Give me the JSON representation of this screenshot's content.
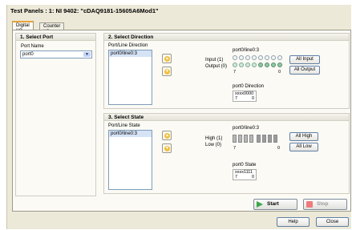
{
  "window": {
    "title": "Test Panels : 1:  NI 9402: \"cDAQ9181-15605A6Mod1\""
  },
  "tabs": [
    {
      "label": "Digital I/O"
    },
    {
      "label": "Counter I/O"
    }
  ],
  "select_port": {
    "title": "1. Select Port",
    "port_name_label": "Port Name",
    "port_value": "port0"
  },
  "direction": {
    "title": "2. Select Direction",
    "list_label": "Port/Line Direction",
    "list_items": [
      "port0/line0:3"
    ],
    "lines_label": "port0/line0:3",
    "input_label": "Input (1)",
    "output_label": "Output (0)",
    "scale_high": "7",
    "scale_low": "0",
    "all_input": "All Input",
    "all_output": "All Output",
    "readout_label": "port0 Direction",
    "readout_value": "xxxx0000",
    "readout_high": "7",
    "readout_low": "0"
  },
  "state": {
    "title": "3. Select State",
    "list_label": "Port/Line State",
    "list_items": [
      "port0/line0:3"
    ],
    "lines_label": "port0/line0:3",
    "high_label": "High (1)",
    "low_label": "Low (0)",
    "scale_high": "7",
    "scale_low": "0",
    "all_high": "All High",
    "all_low": "All Low",
    "readout_label": "port0 State",
    "readout_value": "xxxx1111",
    "readout_high": "7",
    "readout_low": "0"
  },
  "actions": {
    "start": "Start",
    "stop": "Stop"
  },
  "footer": {
    "help": "Help",
    "close": "Close"
  },
  "colors": {
    "accent_tab": "#e8a23c",
    "start_green": "#3aa74a",
    "stop_red": "#ef7b7b"
  }
}
